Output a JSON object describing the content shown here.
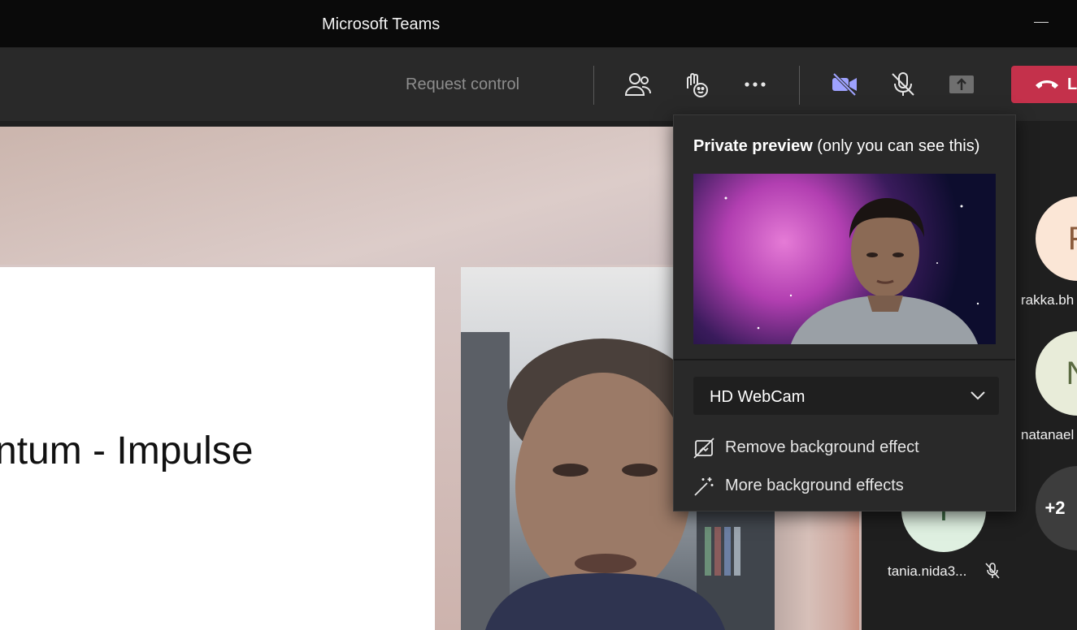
{
  "window": {
    "title": "Microsoft Teams"
  },
  "toolbar": {
    "request_control": "Request control",
    "leave_label": "L"
  },
  "slide": {
    "text": "ntum - Impulse"
  },
  "popup": {
    "heading_bold": "Private preview",
    "heading_rest": " (only you can see this)",
    "camera_selected": "HD WebCam",
    "remove_bg": "Remove background effect",
    "more_bg": "More background effects"
  },
  "participants": [
    {
      "initial": "F",
      "name": "rakka.bh",
      "bg": "#fbe6d6",
      "fg": "#8a5a3b"
    },
    {
      "initial": "N",
      "name": "natanael",
      "bg": "#e8ecd9",
      "fg": "#5b6b42"
    },
    {
      "initial": "T",
      "name": "tania.nida3...",
      "bg": "#dff0e1",
      "fg": "#3d6b44"
    },
    {
      "initial": "+2",
      "name": "",
      "bg": "#3d3d3d",
      "fg": "#ffffff"
    }
  ],
  "colors": {
    "accent": "#9ea2ff",
    "leave": "#c4314b"
  }
}
